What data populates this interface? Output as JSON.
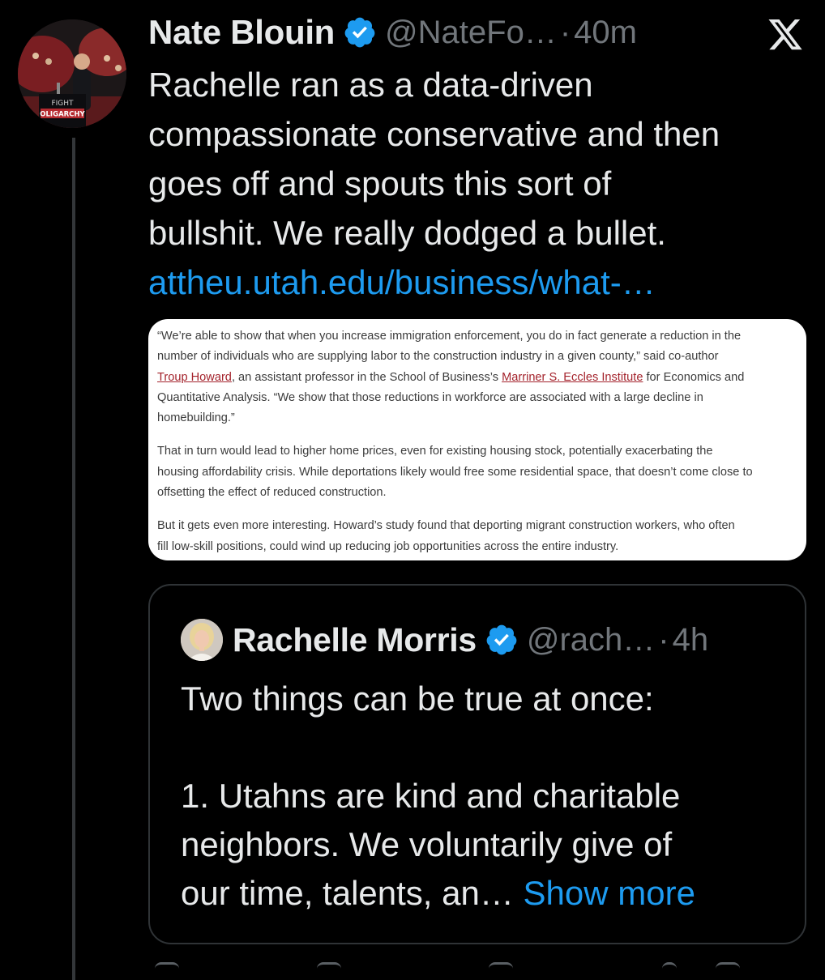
{
  "tweet": {
    "author_name": "Nate Blouin",
    "handle": "@NateFo…",
    "separator": "·",
    "time": "40m",
    "body_lines": [
      "Rachelle ran as a data-driven",
      "compassionate conservative and then",
      "goes off and spouts this sort of",
      "bullshit. We really dodged a bullet."
    ],
    "link_text": "attheu.utah.edu/business/what-…",
    "avatar_sign_text": [
      "FIGHT",
      "OLIGARCHY"
    ]
  },
  "article_image": {
    "paragraphs": [
      [
        [
          {
            "t": "“We’re able to show that when you increase immigration enforcement, you do in fact generate a reduction in the"
          }
        ],
        [
          {
            "t": "number of individuals who are supplying labor to the construction industry in a given county,” said co-author"
          }
        ],
        [
          {
            "t": "Troup Howard",
            "link": true
          },
          {
            "t": ", an assistant professor in the School of Business’s "
          },
          {
            "t": "Marriner S. Eccles Institute",
            "link": true
          },
          {
            "t": " for Economics and"
          }
        ],
        [
          {
            "t": "Quantitative Analysis. “We show that those reductions in workforce are associated with a large decline in"
          }
        ],
        [
          {
            "t": "homebuilding.”"
          }
        ]
      ],
      [
        [
          {
            "t": "That in turn would lead to higher home prices, even for existing housing stock, potentially exacerbating the"
          }
        ],
        [
          {
            "t": "housing affordability crisis. While deportations likely would free some residential space, that doesn’t come close to"
          }
        ],
        [
          {
            "t": "offsetting the effect of reduced construction."
          }
        ]
      ],
      [
        [
          {
            "t": "But it gets even more interesting. Howard’s study found that deporting migrant construction workers, who often"
          }
        ],
        [
          {
            "t": "fill low-skill positions, could wind up reducing job opportunities across the entire industry."
          }
        ]
      ]
    ]
  },
  "quoted_tweet": {
    "author_name": "Rachelle Morris",
    "handle": "@rach…",
    "separator": "·",
    "time": "4h",
    "lines": [
      "Two things can be true at once:",
      "",
      "1. Utahns are kind and charitable",
      "neighbors. We voluntarily give of"
    ],
    "last_line_text": "our time, talents, an…",
    "show_more": "Show more"
  },
  "colors": {
    "background": "#000000",
    "text": "#e7e9ea",
    "muted": "#71767b",
    "link": "#1d9bf0",
    "verified": "#1d9bf0",
    "article_link": "#a4232c"
  },
  "icons": {
    "verified": "verified-badge-icon",
    "platform": "x-logo-icon"
  }
}
